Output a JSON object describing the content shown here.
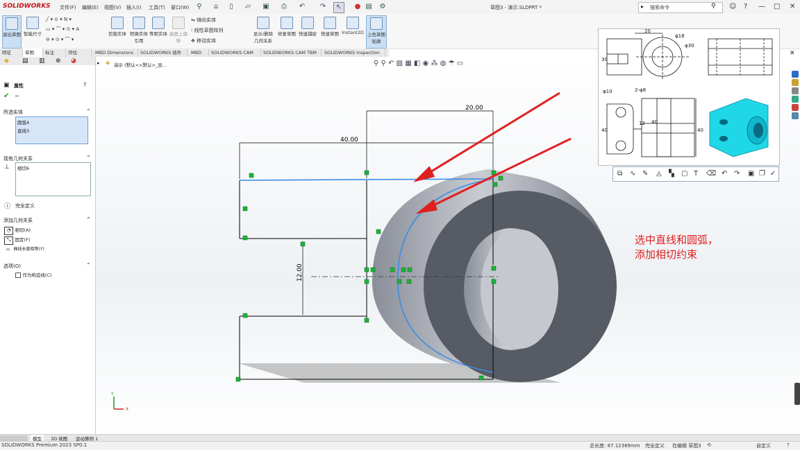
{
  "app": {
    "logo": "SOLIDWORKS",
    "title": "草图3 - 演示.SLDPRT *",
    "search_placeholder": "搜索命令",
    "menus": [
      "文件(F)",
      "编辑(E)",
      "视图(V)",
      "插入(I)",
      "工具(T)",
      "窗口(W)"
    ]
  },
  "ribbon": {
    "buttons": [
      {
        "label": "退出草图",
        "active": true
      },
      {
        "label": "智能尺寸"
      },
      {
        "label": "剪裁实体"
      },
      {
        "label": "转换实体引用"
      },
      {
        "label": "等距实体"
      },
      {
        "label": "曲面上偏移"
      },
      {
        "label": "显示/删除几何关系"
      },
      {
        "label": "修复草图"
      },
      {
        "label": "快速捕捉"
      },
      {
        "label": "快速草图"
      },
      {
        "label": "Instant2D"
      },
      {
        "label": "上色草图轮廓",
        "active": true
      }
    ],
    "mirror_label": "镜向实体",
    "linear_pattern_label": "线性草图阵列",
    "move_label": "移动实体"
  },
  "tabs": [
    "特征",
    "草图",
    "标注",
    "评估",
    "MBD Dimensions",
    "SOLIDWORKS 插件",
    "MBD",
    "SOLIDWORKS CAM",
    "SOLIDWORKS CAM TBM",
    "SOLIDWORKS Inspection"
  ],
  "active_tab_index": 1,
  "panel": {
    "title": "属性",
    "selected_entities_header": "所选实体",
    "selected_entities": [
      "圆弧4",
      "直线3"
    ],
    "existing_relations_header": "现有几何关系",
    "existing_relations": [
      "相切6"
    ],
    "status": "完全定义",
    "add_relations_header": "添加几何关系",
    "add_relations": [
      {
        "label": "相切(A)",
        "icon": "tangent-icon"
      },
      {
        "label": "固定(F)",
        "icon": "fix-icon"
      },
      {
        "label": "曲线长度相等(Y)",
        "icon": "equal-curve-icon"
      }
    ],
    "options_header": "选项(O)",
    "construction_label": "作为构造线(C)"
  },
  "breadcrumb": "演示 (默认<<默认>_显...",
  "sketch": {
    "dim_20": "20.00",
    "dim_40": "40.00",
    "dim_12": "12.00"
  },
  "annotation": {
    "line1": "选中直线和圆弧，",
    "line2": "添加相切约束",
    "color": "#e02020"
  },
  "drawing_popup": {
    "dim_20": "20",
    "dim_phi18": "φ18",
    "dim_phi30": "φ30",
    "dim_30": "30",
    "dim_phi10": "φ10",
    "dim_2phi8": "2-φ8",
    "dim_40": "40",
    "dim_40_left": "40",
    "dim_40_right": "40",
    "dim_12": "12"
  },
  "bottom_tabs": [
    "模型",
    "3D 视图",
    "运动算例 1"
  ],
  "status_bar": {
    "product": "SOLIDWORKS Premium 2023 SP0.1",
    "length": "总长度: 87.12389mm",
    "definition": "完全定义",
    "editing": "在编辑 草图3",
    "units": "自定义"
  },
  "colors": {
    "sketch_line": "#000000",
    "selected": "#3a8ee6",
    "relation_marker": "#1db33a",
    "model": "#5f636c",
    "arrow": "#e02020"
  }
}
